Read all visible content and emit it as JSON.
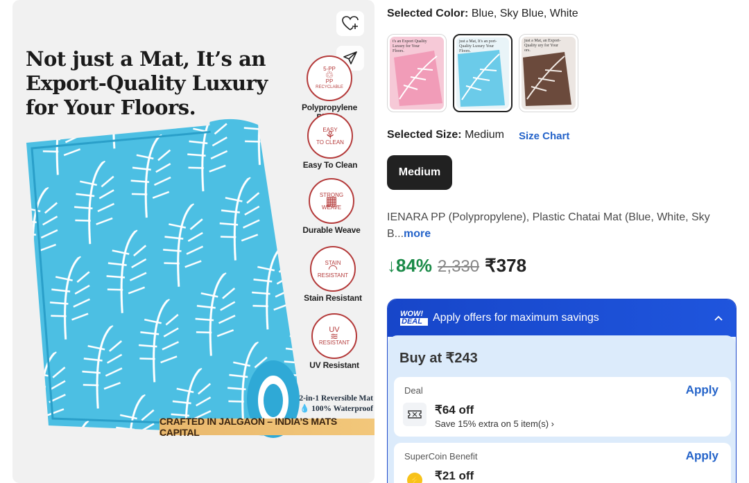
{
  "product_image": {
    "heading": "Not just a Mat, It’s an Export-Quality Luxury for Your Floors.",
    "features": [
      {
        "badge_top": "5-PP",
        "badge_mid": "PP",
        "badge_bottom": "RECYCLABLE",
        "label": "Polypropylene Plastic"
      },
      {
        "badge_top": "EASY",
        "badge_mid": "",
        "badge_bottom": "TO CLEAN",
        "label": "Easy To Clean"
      },
      {
        "badge_top": "STRONG",
        "badge_mid": "",
        "badge_bottom": "WEAVE",
        "label": "Durable Weave"
      },
      {
        "badge_top": "STAIN",
        "badge_mid": "",
        "badge_bottom": "RESISTANT",
        "label": "Stain Resistant"
      },
      {
        "badge_top": "UV",
        "badge_mid": "",
        "badge_bottom": "RESISTANT",
        "label": "UV Resistant"
      }
    ],
    "reversible_line1": "2-in-1 Reversible Mat",
    "reversible_line2": "100% Waterproof",
    "crafted": "CRAFTED IN JALGAON – INDIA’S MATS CAPITAL"
  },
  "color": {
    "label": "Selected Color:",
    "value": "Blue, Sky Blue, White",
    "swatches": [
      {
        "name": "Pink",
        "bg": "#f4b3c7",
        "text": "t's an Export Quality Luxury for Your Floors."
      },
      {
        "name": "Blue, Sky Blue, White",
        "bg": "#7fd0ea",
        "text": "just a Mat, It's an port-Quality Luxury Your Floors."
      },
      {
        "name": "Brown",
        "bg": "#7a5a4a",
        "text": "just a Mat, an Export-Quality ury for Your ors."
      }
    ]
  },
  "size": {
    "label": "Selected Size:",
    "value": "Medium",
    "chart_link": "Size Chart",
    "option": "Medium"
  },
  "description": {
    "text": "IENARA PP (Polypropylene), Plastic Chatai Mat (Blue, White, Sky B...",
    "more": "more"
  },
  "pricing": {
    "discount": "↓84%",
    "mrp": "2,330",
    "price": "₹378"
  },
  "offers": {
    "wow_line1": "WOW!",
    "wow_line2": "DEAL",
    "title": "Apply offers for maximum savings",
    "buy_at": "Buy at ₹243",
    "cards": [
      {
        "tag": "Deal",
        "apply": "Apply",
        "off": "₹64 off",
        "sub": "Save 15% extra on 5 item(s) ›"
      },
      {
        "tag": "SuperCoin Benefit",
        "apply": "Apply",
        "off": "₹21 off",
        "sub": ""
      }
    ]
  }
}
